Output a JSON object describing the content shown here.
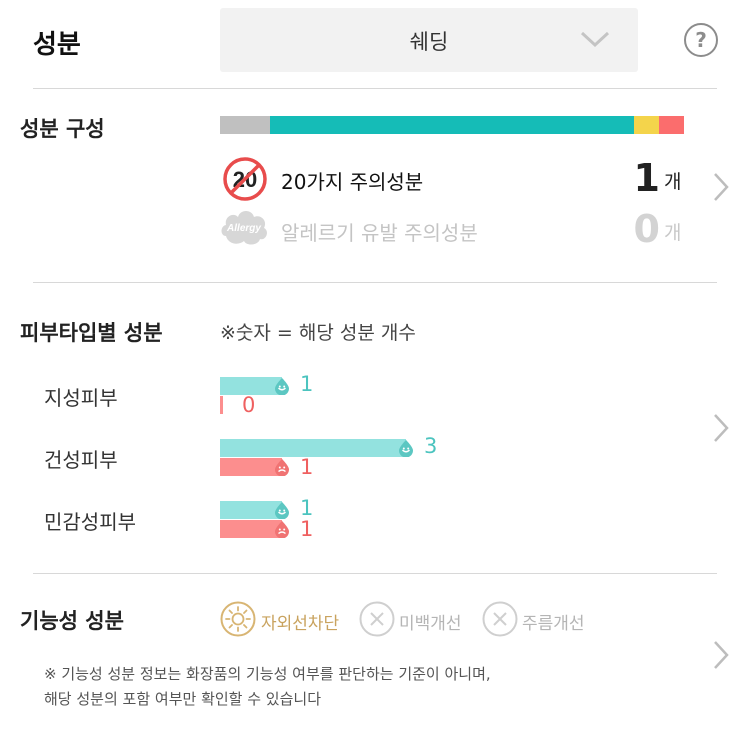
{
  "header": {
    "title": "성분",
    "product_selector": "쉐딩",
    "help_symbol": "?"
  },
  "composition": {
    "title": "성분 구성",
    "bar_segments": [
      {
        "share": 0.108,
        "color": "#c0c0c0"
      },
      {
        "share": 0.784,
        "color": "#15bcb7"
      },
      {
        "share": 0.054,
        "color": "#f4d44b"
      },
      {
        "share": 0.054,
        "color": "#fb6d6d"
      }
    ],
    "rows": [
      {
        "icon": "twenty-caution-icon",
        "icon_text": "20",
        "label": "20가지 주의성분",
        "count": "1",
        "unit": "개"
      },
      {
        "icon": "allergy-icon",
        "icon_text": "Allergy",
        "label": "알레르기 유발 주의성분",
        "count": "0",
        "unit": "개"
      }
    ]
  },
  "skin_type": {
    "title": "피부타입별 성분",
    "note": "※숫자 = 해당 성분 개수",
    "rows": [
      {
        "label": "지성피부",
        "good": 1,
        "bad": 0
      },
      {
        "label": "건성피부",
        "good": 3,
        "bad": 1
      },
      {
        "label": "민감성피부",
        "good": 1,
        "bad": 1
      }
    ],
    "colors": {
      "good": "#93e2df",
      "bad": "#fc8e8e"
    }
  },
  "functional": {
    "title": "기능성 성분",
    "items": [
      {
        "label": "자외선차단",
        "active": true,
        "icon": "sun-icon"
      },
      {
        "label": "미백개선",
        "active": false,
        "icon": "x-circle-icon"
      },
      {
        "label": "주름개선",
        "active": false,
        "icon": "x-circle-icon"
      }
    ],
    "footnote_line1": "※ 기능성 성분 정보는 화장품의 기능성 여부를 판단하는 기준이 아니며,",
    "footnote_line2": "해당 성분의 포함 여부만 확인할 수 있습니다"
  },
  "colors": {
    "accent": "#15bcb7",
    "warning": "#fb6d6d",
    "sun": "#d8b573"
  }
}
